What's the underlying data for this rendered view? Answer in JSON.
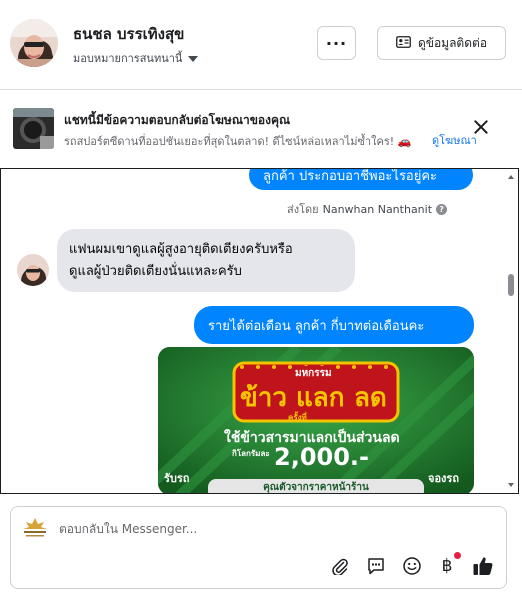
{
  "header": {
    "contact_name": "ธนชล บรรเทิงสุข",
    "assignee_label": "มอบหมายการสนทนานี้",
    "more_label": "···",
    "contact_info_label": "ดูข้อมูลติดต่อ"
  },
  "ad_banner": {
    "title": "แชทนี้มีข้อความตอบกลับต่อโฆษณาของคุณ",
    "subtitle": "รถสปอร์ตซีดานที่ออปชันเยอะที่สุดในตลาด! ดีไซน์หล่อเหลาไม่ซ้ำใคร! 🚗",
    "view_ad_label": "ดูโฆษณา"
  },
  "messages": {
    "outgoing_1": "ลูกค้า ประกอบอาชีพอะไรอยู่คะ",
    "sent_by_prefix": "ส่งโดย",
    "sent_by_name": "Nanwhan Nanthanit",
    "incoming_1_line1": "แฟนผมเขาดูแลผู้สูงอายุติดเตียงครับหรือ",
    "incoming_1_line2": "ดูแลผู้ป่วยติดเตียงนั่นแหละครับ",
    "outgoing_2": "รายได้ต่อเดือน ลูกค้า  กี่บาทต่อเดือนคะ",
    "promo": {
      "top_label": "มหกรรม",
      "headline_1": "ข้าว",
      "headline_2": "แลก",
      "headline_3": "ลด",
      "round_label": "ครั้งที่",
      "subline": "ใช้ข้าวสารมาแลกเป็นส่วนลด",
      "per_kg": "กิโลกรัมละ",
      "amount": "2,000.-",
      "left_label": "รับรถ",
      "right_label": "จองรถ",
      "footer": "คุณตัวจากราคาหน้าร้าน"
    }
  },
  "composer": {
    "placeholder": "ตอบกลับใน Messenger...",
    "pay_symbol": "฿"
  },
  "colors": {
    "accent": "#0084ff",
    "incoming_bubble": "#e4e6eb",
    "link": "#1877f2",
    "promo_green": "#1f7a2a",
    "promo_gold": "#f5c400",
    "notification_dot": "#e41e3f"
  },
  "icons": [
    "user-avatar",
    "more-icon",
    "contact-card-icon",
    "car-thumbnail",
    "close-icon",
    "info-icon",
    "page-logo",
    "attachment-icon",
    "saved-reply-icon",
    "emoji-icon",
    "payment-icon",
    "thumbs-up-icon"
  ]
}
